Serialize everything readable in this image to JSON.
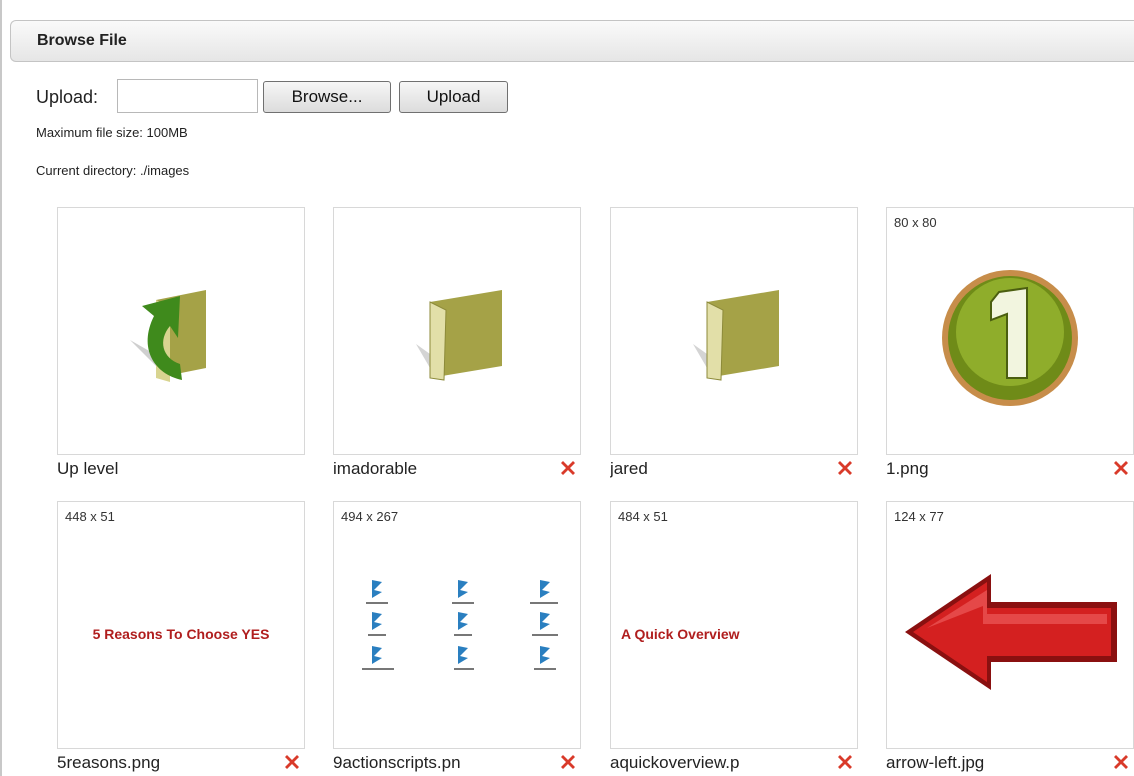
{
  "header": {
    "title": "Browse File"
  },
  "upload": {
    "label": "Upload:",
    "browse_label": "Browse...",
    "upload_label": "Upload",
    "max_size": "Maximum file size: 100MB",
    "current_dir": "Current directory: ./images"
  },
  "files": [
    {
      "name": "Up level",
      "dims": "",
      "icon": "up-level-folder-icon",
      "deletable": false
    },
    {
      "name": "imadorable",
      "dims": "",
      "icon": "folder-icon",
      "deletable": true
    },
    {
      "name": "jared",
      "dims": "",
      "icon": "folder-icon",
      "deletable": true
    },
    {
      "name": "1.png",
      "dims": "80 x 80",
      "icon": "number-one-badge",
      "deletable": true
    },
    {
      "name": "5reasons.png",
      "dims": "448 x 51",
      "icon": "text-banner",
      "banner_text": "5 Reasons To Choose YES",
      "deletable": true
    },
    {
      "name": "9actionscripts.pn",
      "dims": "494 x 267",
      "icon": "file-grid-thumbnail",
      "deletable": true
    },
    {
      "name": "aquickoverview.p",
      "dims": "484 x 51",
      "icon": "text-banner",
      "banner_text": "A Quick Overview",
      "deletable": true
    },
    {
      "name": "arrow-left.jpg",
      "dims": "124 x 77",
      "icon": "red-arrow-left",
      "deletable": true
    }
  ],
  "colors": {
    "banner_red": "#b01e1e",
    "delete_red": "#d93a2a",
    "folder_olive": "#a5a247",
    "arrow_green": "#3f8a1c",
    "arrow_red": "#d42020"
  }
}
